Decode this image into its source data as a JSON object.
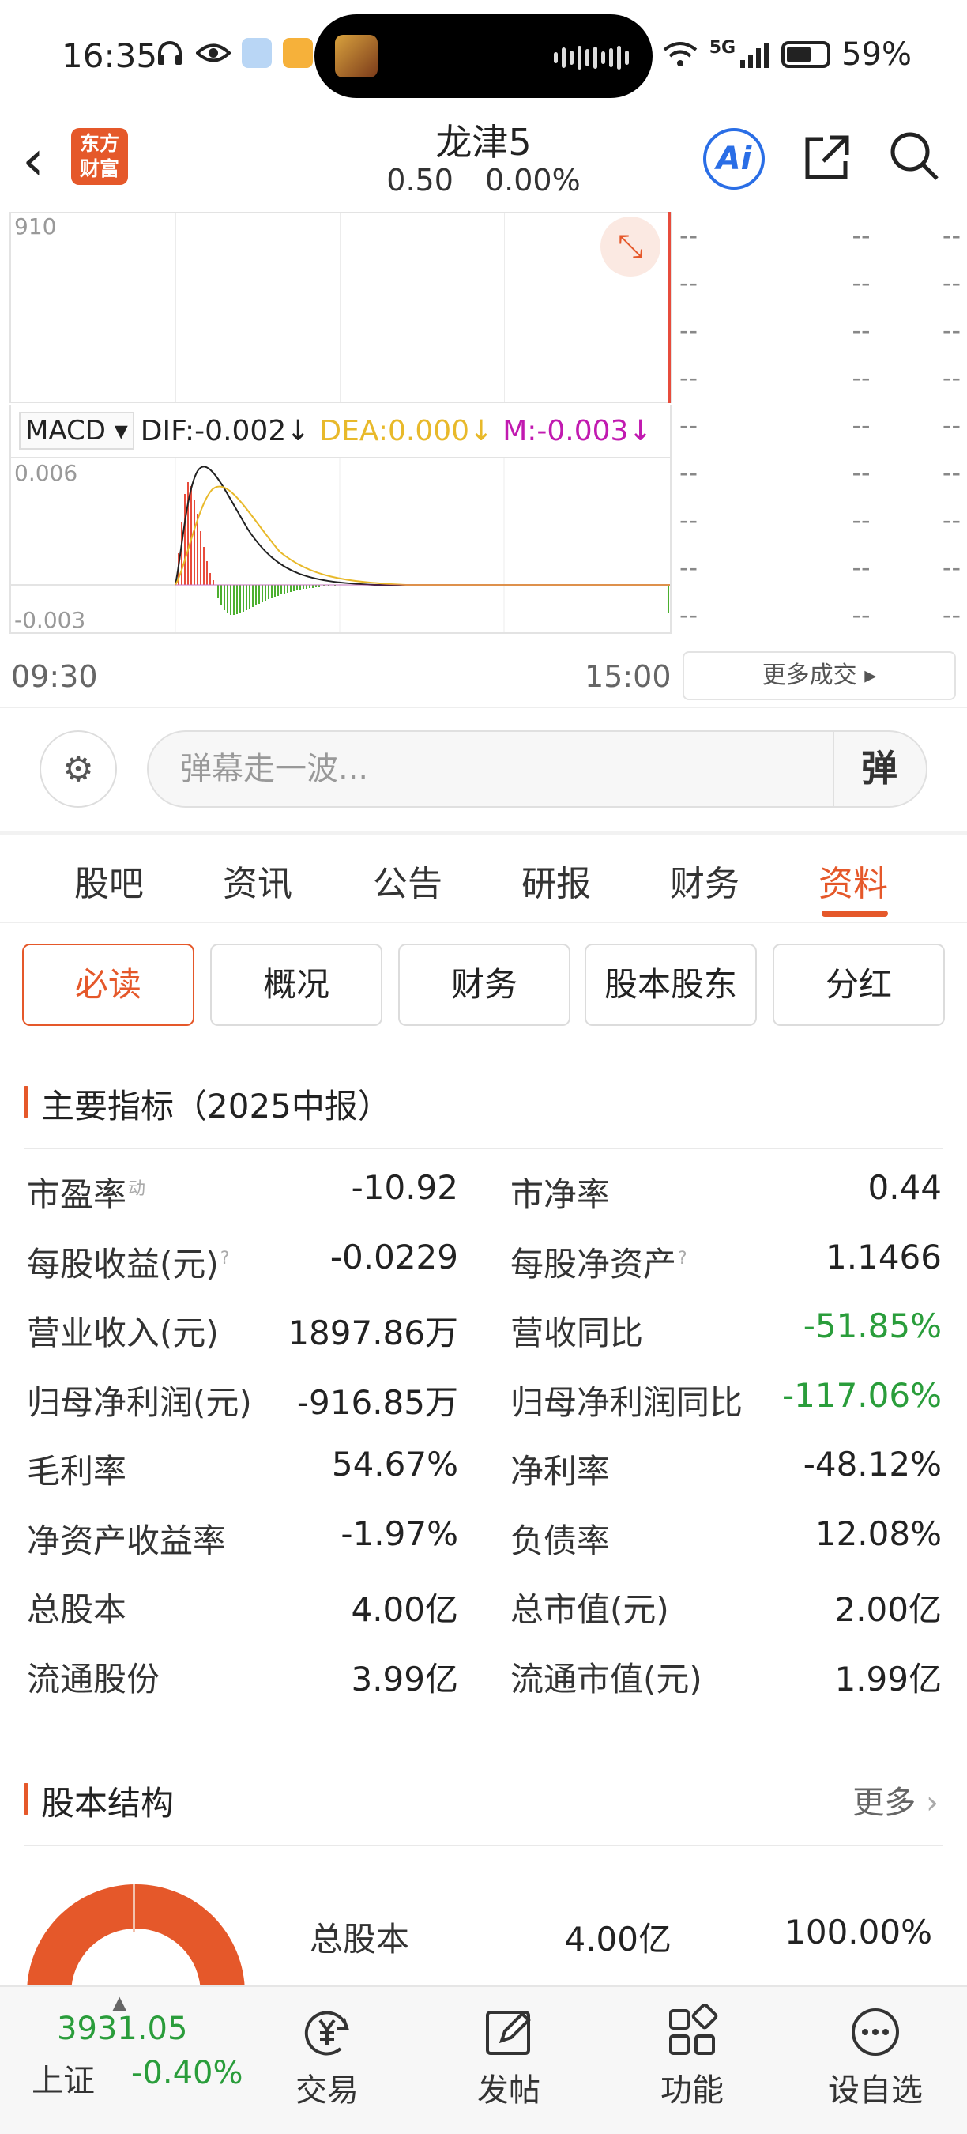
{
  "status_bar": {
    "time": "16:35",
    "network": "5G",
    "battery": "59%"
  },
  "header": {
    "title": "龙津5",
    "price": "0.50",
    "change_pct": "0.00%",
    "logo_text": [
      "东方",
      "财富"
    ],
    "ai_label": "Ai"
  },
  "chart": {
    "y_top_label": "910",
    "macd_indicator": "MACD",
    "dif": "DIF:-0.002↓",
    "dea": "DEA:0.000↓",
    "m": "M:-0.003↓",
    "macd_y_max": "0.006",
    "macd_y_min": "-0.003",
    "time_start": "09:30",
    "time_end": "15:00",
    "colors": {
      "dif": "#222222",
      "dea": "#e8b92a",
      "m": "#c11ab0",
      "up": "#e74c3c",
      "down": "#4caf2f"
    }
  },
  "ticker": {
    "rows": [
      [
        "--",
        "--",
        "--"
      ],
      [
        "--",
        "--",
        "--"
      ],
      [
        "--",
        "--",
        "--"
      ],
      [
        "--",
        "--",
        "--"
      ],
      [
        "--",
        "--",
        "--"
      ],
      [
        "--",
        "--",
        "--"
      ],
      [
        "--",
        "--",
        "--"
      ],
      [
        "--",
        "--",
        "--"
      ],
      [
        "--",
        "--",
        "--"
      ]
    ],
    "more_label": "更多成交 ▸"
  },
  "danmaku": {
    "placeholder": "弹幕走一波...",
    "send_label": "弹"
  },
  "tabs": [
    {
      "label": "股吧"
    },
    {
      "label": "资讯"
    },
    {
      "label": "公告"
    },
    {
      "label": "研报"
    },
    {
      "label": "财务"
    },
    {
      "label": "资料",
      "active": true
    }
  ],
  "subtabs": [
    {
      "label": "必读",
      "active": true
    },
    {
      "label": "概况"
    },
    {
      "label": "财务"
    },
    {
      "label": "股本股东"
    },
    {
      "label": "分红"
    }
  ],
  "key_metrics": {
    "title": "主要指标（2025中报）",
    "left": [
      {
        "label": "市盈率",
        "sup": "动",
        "value": "-10.92"
      },
      {
        "label": "每股收益(元)",
        "sup": "?",
        "value": "-0.0229"
      },
      {
        "label": "营业收入(元)",
        "value": "1897.86万"
      },
      {
        "label": "归母净利润(元)",
        "value": "-916.85万"
      },
      {
        "label": "毛利率",
        "value": "54.67%"
      },
      {
        "label": "净资产收益率",
        "value": "-1.97%"
      },
      {
        "label": "总股本",
        "value": "4.00亿"
      },
      {
        "label": "流通股份",
        "value": "3.99亿"
      }
    ],
    "right": [
      {
        "label": "市净率",
        "value": "0.44"
      },
      {
        "label": "每股净资产",
        "sup": "?",
        "value": "1.1466"
      },
      {
        "label": "营收同比",
        "value": "-51.85%",
        "green": true
      },
      {
        "label": "归母净利润同比",
        "value": "-117.06%",
        "green": true
      },
      {
        "label": "净利率",
        "value": "-48.12%"
      },
      {
        "label": "负债率",
        "value": "12.08%"
      },
      {
        "label": "总市值(元)",
        "value": "2.00亿"
      },
      {
        "label": "流通市值(元)",
        "value": "1.99亿"
      }
    ]
  },
  "share_structure": {
    "title": "股本结构",
    "more": "更多",
    "row": {
      "label": "总股本",
      "value": "4.00亿",
      "pct": "100.00%"
    }
  },
  "bottom_nav": {
    "index_value": "3931.05",
    "index_name": "上证",
    "index_change": "-0.40%",
    "items": [
      {
        "label": "交易",
        "icon": "yen-exchange-icon"
      },
      {
        "label": "发帖",
        "icon": "edit-icon"
      },
      {
        "label": "功能",
        "icon": "grid-icon"
      },
      {
        "label": "设自选",
        "icon": "more-icon"
      }
    ]
  }
}
